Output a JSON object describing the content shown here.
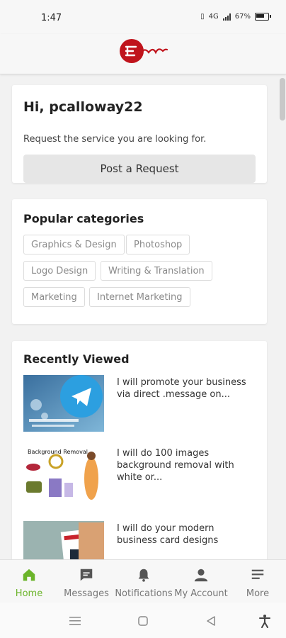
{
  "status_bar": {
    "time": "1:47",
    "battery": "67%",
    "network": "4G"
  },
  "app": {
    "brand_color": "#c0141c",
    "accent_color": "#6bb42a"
  },
  "greeting": {
    "title": "Hi, pcalloway22",
    "subtitle": "Request the service you are looking for.",
    "button_label": "Post a Request"
  },
  "categories": {
    "title": "Popular categories",
    "items": [
      "Graphics & Design",
      "Photoshop",
      "Logo Design",
      "Writing & Translation",
      "Marketing",
      "Internet Marketing"
    ]
  },
  "recent": {
    "title": "Recently Viewed",
    "items": [
      {
        "text": "I will promote your business via direct .message on...",
        "thumb_icon": "telegram-icon"
      },
      {
        "text": "I will do 100 images background removal with white or...",
        "thumb_icon": "background-removal-collage",
        "thumb_caption": "Background Removal"
      },
      {
        "text": "I will do your modern business card designs",
        "thumb_icon": "business-card-icon"
      }
    ]
  },
  "bottom_nav": {
    "items": [
      {
        "label": "Home",
        "icon": "home-icon",
        "active": true
      },
      {
        "label": "Messages",
        "icon": "messages-icon"
      },
      {
        "label": "Notifications",
        "icon": "bell-icon"
      },
      {
        "label": "My Account",
        "icon": "user-icon"
      },
      {
        "label": "More",
        "icon": "menu-icon"
      }
    ]
  }
}
